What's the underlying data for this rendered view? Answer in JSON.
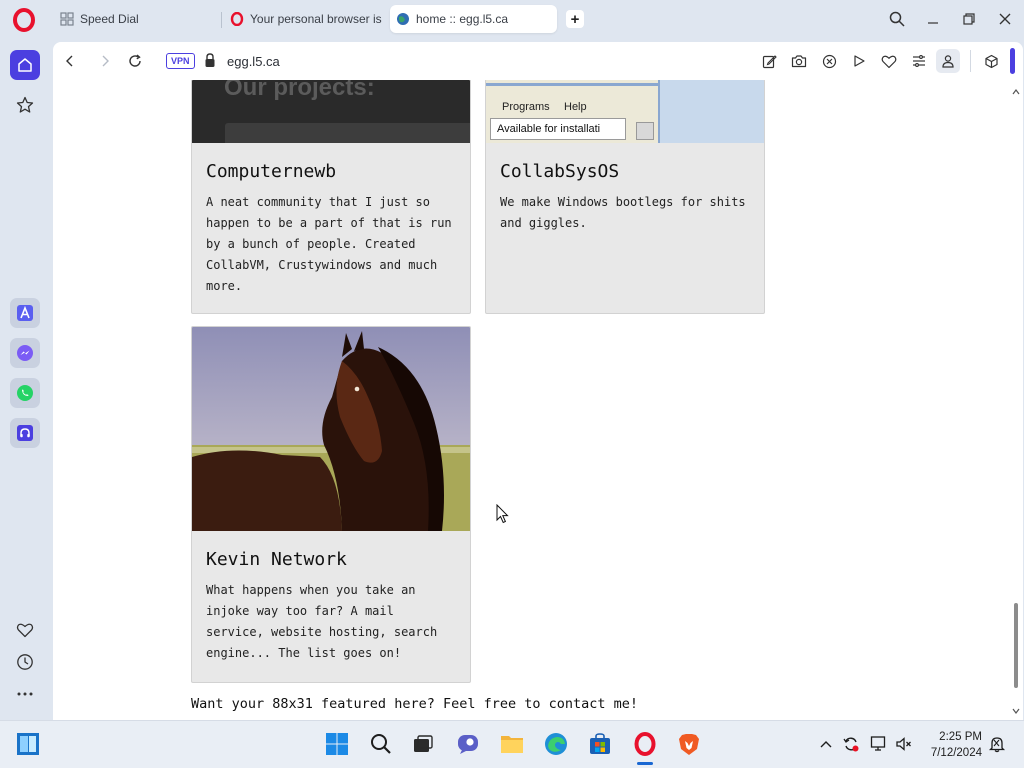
{
  "browser": {
    "tabs": [
      {
        "title": "Speed Dial",
        "icon": "speed-dial-grid-icon"
      },
      {
        "title": "Your personal browser is",
        "icon": "opera-icon"
      },
      {
        "title": "home :: egg.l5.ca",
        "icon": "globe-icon",
        "active": true
      }
    ],
    "new_tab": "+",
    "vpn_label": "VPN",
    "url": "egg.l5.ca",
    "accent_color": "#4b3fe0"
  },
  "page": {
    "cards": [
      {
        "image_caption": "Our projects:",
        "title": "Computernewb",
        "description": "A neat community that I just so happen to be a part of that is run by a bunch of people. Created CollabVM, Crustywindows and much more."
      },
      {
        "image_menu": [
          "Programs",
          "Help"
        ],
        "image_text": "Available for installati",
        "title": "CollabSysOS",
        "description": "We make Windows bootlegs for shits and giggles."
      },
      {
        "image": "horse-photo",
        "title": "Kevin Network",
        "description": "What happens when you take an injoke way too far? A mail service, website hosting, search engine... The list goes on!"
      }
    ],
    "footer": "Want your 88x31 featured here? Feel free to contact me!"
  },
  "taskbar": {
    "time": "2:25 PM",
    "date": "7/12/2024"
  }
}
